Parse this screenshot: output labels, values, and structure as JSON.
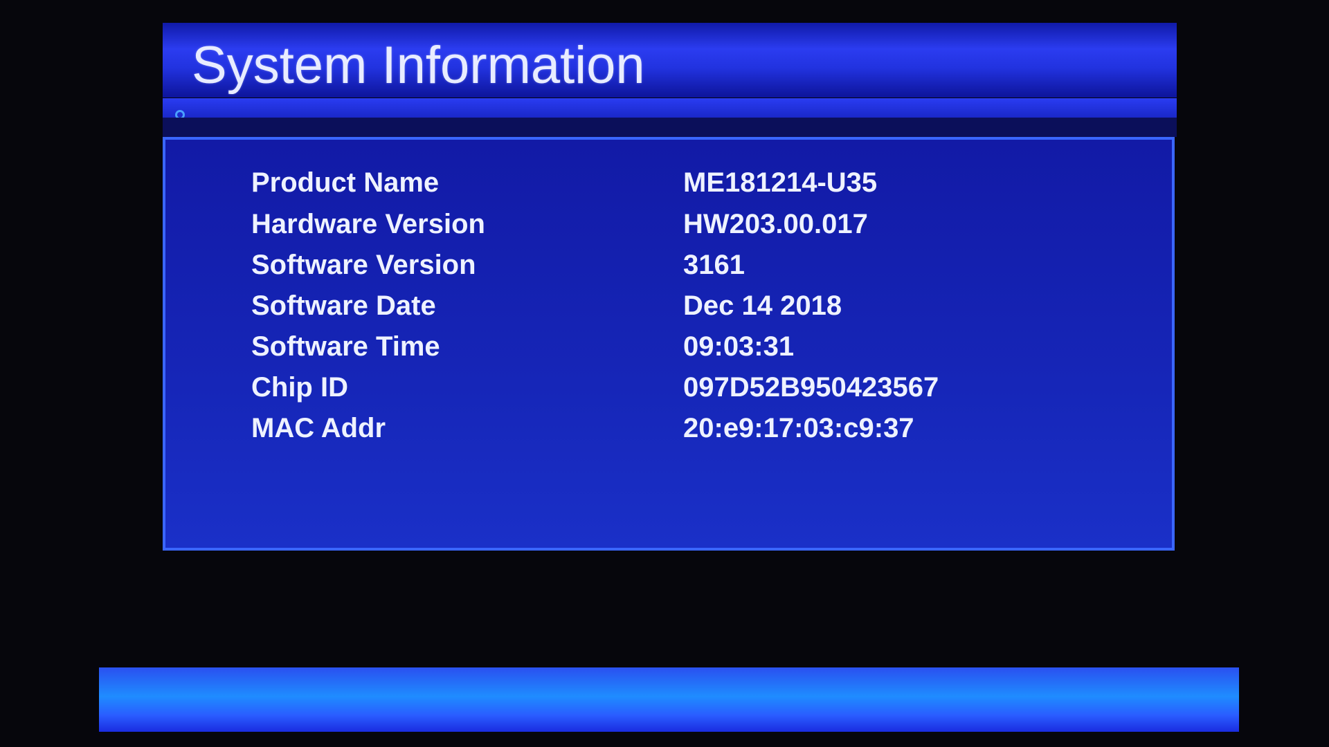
{
  "header": {
    "title": "System Information"
  },
  "subbar": {
    "icon": "circle-indicator-icon"
  },
  "info": {
    "rows": [
      {
        "label": "Product Name",
        "value": "ME181214-U35"
      },
      {
        "label": "Hardware Version",
        "value": "HW203.00.017"
      },
      {
        "label": "Software Version",
        "value": "3161"
      },
      {
        "label": "Software Date",
        "value": "Dec 14 2018"
      },
      {
        "label": "Software Time",
        "value": "09:03:31"
      },
      {
        "label": "Chip ID",
        "value": "097D52B950423567"
      },
      {
        "label": "MAC Addr",
        "value": "20:e9:17:03:c9:37"
      }
    ]
  },
  "colors": {
    "accent": "#2b3cf0",
    "panel": "#1626b8",
    "text": "#eef2ff",
    "bottom_bar": "#1f8cff"
  }
}
